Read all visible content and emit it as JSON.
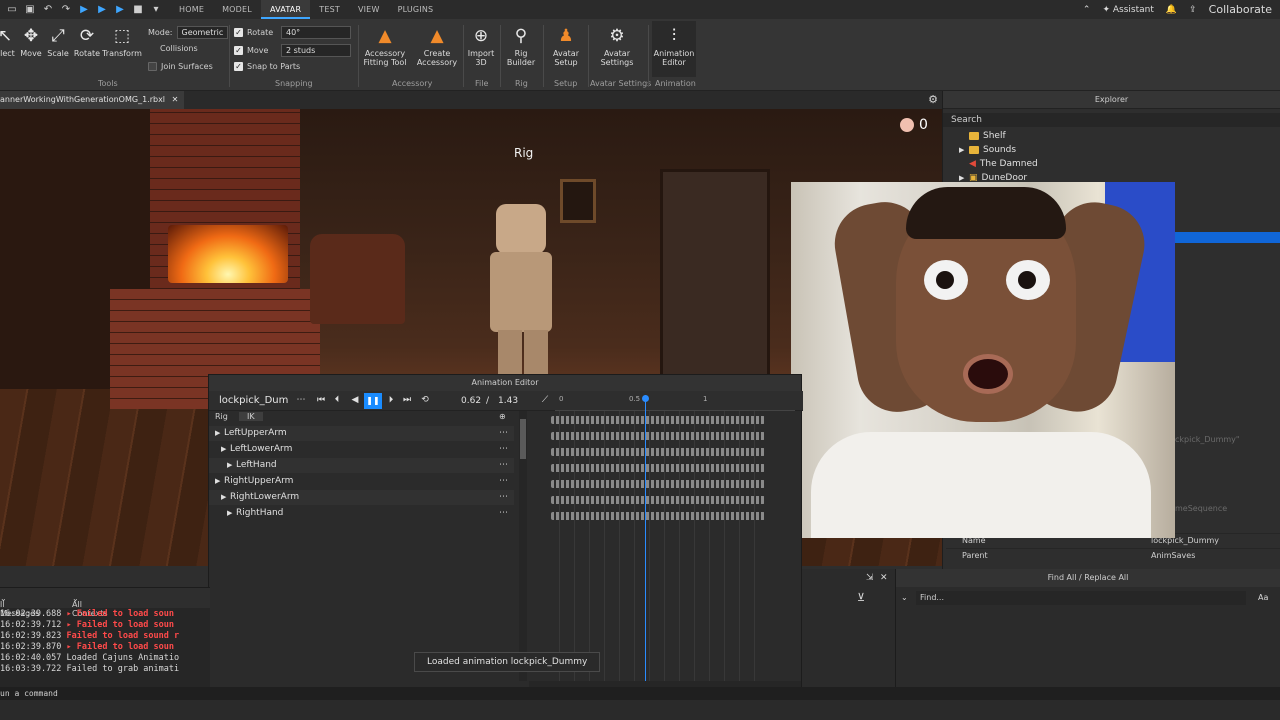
{
  "menubar": {
    "tabs": [
      "HOME",
      "MODEL",
      "AVATAR",
      "TEST",
      "VIEW",
      "PLUGINS"
    ],
    "active_tab": "AVATAR",
    "assistant": "Assistant",
    "collaborate": "Collaborate"
  },
  "ribbon": {
    "tools": [
      "elect",
      "Move",
      "Scale",
      "Rotate",
      "Transform"
    ],
    "tools_group": "Tools",
    "mode_label": "Mode:",
    "mode_value": "Geometric",
    "collisions": "Collisions",
    "join_surfaces": "Join Surfaces",
    "rotate_label": "Rotate",
    "rotate_value": "40°",
    "move_label": "Move",
    "move_value": "2 studs",
    "snap_to_parts": "Snap to Parts",
    "snapping_group": "Snapping",
    "accessory_fitting_1": "Accessory",
    "accessory_fitting_2": "Fitting Tool",
    "create_accessory_1": "Create",
    "create_accessory_2": "Accessory",
    "accessory_group": "Accessory",
    "import_1": "Import",
    "import_2": "3D",
    "file_group": "File",
    "rig_builder_1": "Rig",
    "rig_builder_2": "Builder",
    "rig_group": "Rig",
    "avatar_setup_1": "Avatar",
    "avatar_setup_2": "Setup",
    "setup_group": "Setup",
    "avatar_settings_1": "Avatar",
    "avatar_settings_2": "Settings",
    "avatar_settings_group": "Avatar Settings",
    "anim_editor_1": "Animation",
    "anim_editor_2": "Editor",
    "animation_group": "Animation"
  },
  "doc_tab": "annerWorkingWithGenerationOMG_1.rbxl",
  "viewport": {
    "rig_label": "Rig",
    "hat_count": "0"
  },
  "explorer": {
    "title": "Explorer",
    "search": "Search",
    "items": [
      {
        "name": "Shelf",
        "type": "folder"
      },
      {
        "name": "Sounds",
        "type": "folder"
      },
      {
        "name": "The Damned",
        "type": "sound"
      },
      {
        "name": "DuneDoor",
        "type": "model"
      }
    ]
  },
  "properties": {
    "ghost_value": "ckpick_Dummy\"",
    "ghost_sequence": "meSequence",
    "rows": [
      {
        "key": "Name",
        "value": "lockpick_Dummy"
      },
      {
        "key": "Parent",
        "value": "AnimSaves"
      }
    ]
  },
  "animation_editor": {
    "title": "Animation Editor",
    "animation_name": "lockpick_Dum",
    "current_time": "0.62",
    "time_sep": "/",
    "total_time": "1.43",
    "tab_rig": "Rig",
    "tab_ik": "IK",
    "ruler": [
      "0",
      "0.5",
      "1"
    ],
    "tracks": [
      {
        "name": "LeftUpperArm",
        "indent": 0
      },
      {
        "name": "LeftLowerArm",
        "indent": 1
      },
      {
        "name": "LeftHand",
        "indent": 2
      },
      {
        "name": "RightUpperArm",
        "indent": 0
      },
      {
        "name": "RightLowerArm",
        "indent": 1
      },
      {
        "name": "RightHand",
        "indent": 2
      }
    ],
    "toast": "Loaded animation lockpick_Dummy"
  },
  "output": {
    "filter_messages": "ll Messages",
    "filter_contexts": "All Contexts",
    "logs": [
      {
        "ts": "16:02:39.688",
        "text": " ▸ Failed to load soun",
        "kind": "err"
      },
      {
        "ts": "16:02:39.712",
        "text": " ▸ Failed to load soun",
        "kind": "err"
      },
      {
        "ts": "16:02:39.823",
        "text": " Failed to load sound r",
        "kind": "err"
      },
      {
        "ts": "16:02:39.870",
        "text": " ▸ Failed to load soun",
        "kind": "err"
      },
      {
        "ts": "16:02:40.057",
        "text": " Loaded Cajuns Animatio",
        "kind": "msg"
      },
      {
        "ts": "16:03:39.722",
        "text": " Failed to grab animati",
        "kind": "msg"
      }
    ]
  },
  "find_panel": {
    "title": "Find All / Replace All",
    "placeholder": "Find...",
    "case_toggle": "Aa"
  },
  "command_bar": "un a command"
}
